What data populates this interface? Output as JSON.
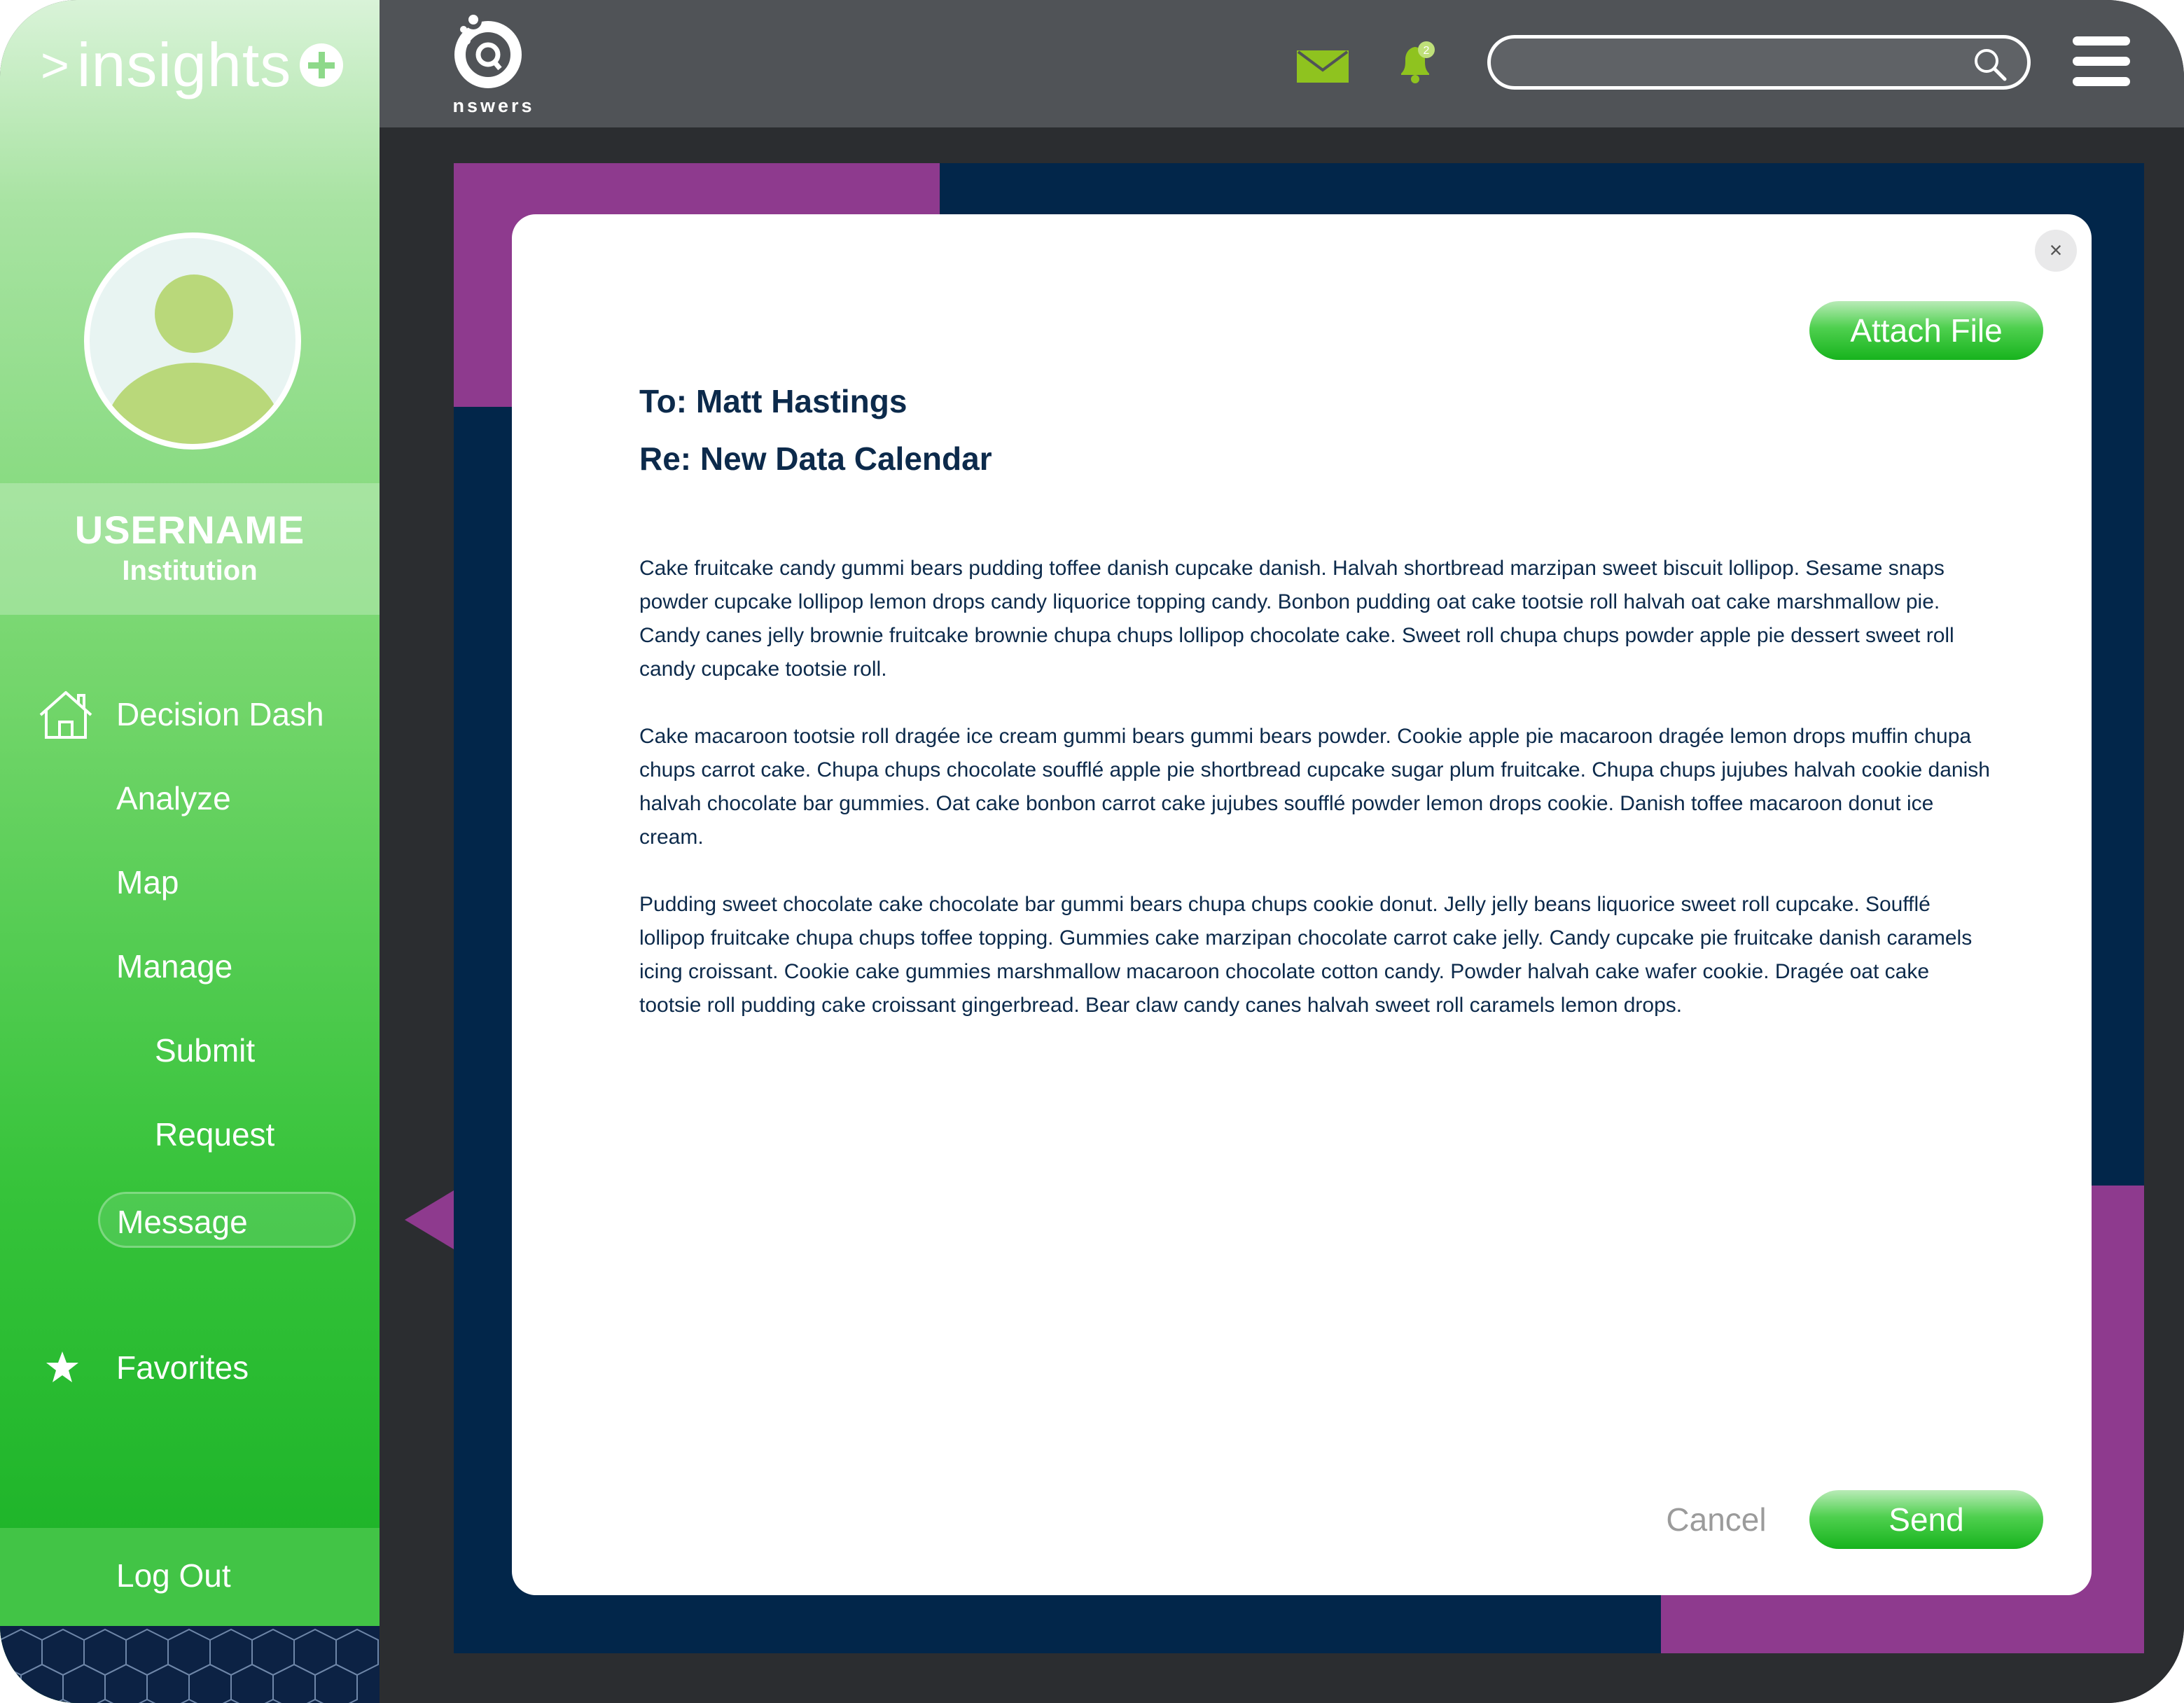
{
  "app": {
    "brand": "insights",
    "brand_prefix": ">",
    "logo_word": "nswers"
  },
  "user": {
    "name": "USERNAME",
    "institution": "Institution"
  },
  "sidebar": {
    "items": [
      {
        "label": "Decision Dash",
        "icon": "home-icon"
      },
      {
        "label": "Analyze"
      },
      {
        "label": "Map"
      },
      {
        "label": "Manage"
      },
      {
        "label": "Submit"
      },
      {
        "label": "Request"
      },
      {
        "label": "Message",
        "active": true
      }
    ],
    "favorites": {
      "label": "Favorites",
      "icon": "star-icon"
    },
    "logout": {
      "label": "Log Out"
    }
  },
  "header": {
    "notification_count": "2",
    "search_placeholder": ""
  },
  "message": {
    "to": "To: Matt Hastings",
    "re": "Re: New Data Calendar",
    "attach_label": "Attach File",
    "cancel_label": "Cancel",
    "send_label": "Send",
    "close_symbol": "×",
    "paragraphs": [
      "Cake fruitcake candy gummi bears pudding toffee danish cupcake danish. Halvah shortbread marzipan sweet biscuit lollipop. Sesame snaps powder cupcake lollipop lemon drops candy liquorice topping candy. Bonbon pudding oat cake tootsie roll halvah oat cake marshmallow pie. Candy canes jelly brownie fruitcake brownie chupa chups lollipop chocolate cake. Sweet roll chupa chups powder apple pie dessert sweet roll candy cupcake tootsie roll.",
      "Cake macaroon tootsie roll dragée ice cream gummi bears gummi bears powder. Cookie apple pie macaroon dragée lemon drops muffin chupa chups carrot cake. Chupa chups chocolate soufflé apple pie shortbread cupcake sugar plum fruitcake. Chupa chups jujubes halvah cookie danish halvah chocolate bar gummies. Oat cake bonbon carrot cake jujubes soufflé powder lemon drops cookie. Danish toffee macaroon donut ice cream.",
      "Pudding sweet chocolate cake chocolate bar gummi bears chupa chups cookie donut. Jelly jelly beans liquorice sweet roll cupcake. Soufflé lollipop fruitcake chupa chups toffee topping. Gummies cake marzipan chocolate carrot cake jelly. Candy cupcake pie fruitcake danish caramels icing croissant. Cookie cake gummies marshmallow macaroon chocolate cotton candy. Powder halvah cake wafer cookie. Dragée oat cake tootsie roll pudding cake croissant gingerbread. Bear claw candy canes halvah sweet roll caramels lemon drops."
    ]
  },
  "colors": {
    "accent_green": "#1fb52a",
    "navy": "#02264a",
    "purple": "#8e3a8e",
    "topbar": "#505357",
    "icon_green": "#8fc31f"
  }
}
